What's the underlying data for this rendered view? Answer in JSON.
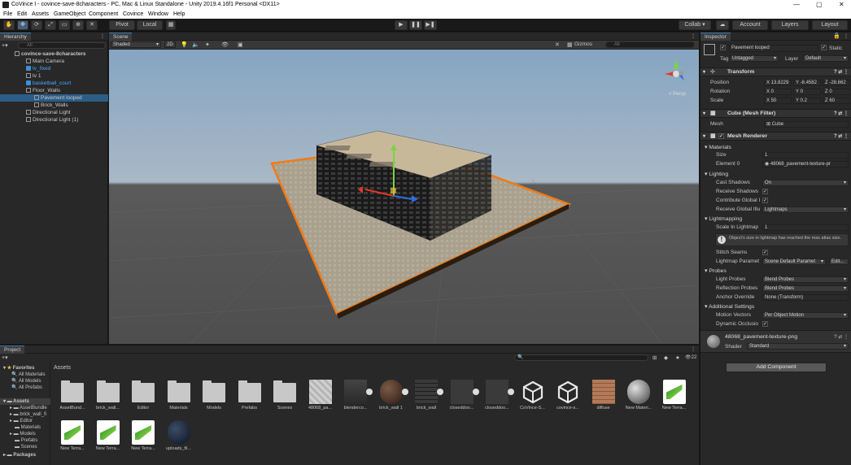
{
  "window": {
    "title": "CoVince I - covince-save-8characters - PC, Mac & Linux Standalone - Unity 2019.4.16f1 Personal <DX11>",
    "controls": [
      "—",
      "▢",
      "✕"
    ]
  },
  "menu": [
    "File",
    "Edit",
    "Assets",
    "GameObject",
    "Component",
    "Covince",
    "Window",
    "Help"
  ],
  "toolbar": {
    "pivot": "Pivot",
    "local": "Local",
    "collab": "Collab ▾",
    "account": "Account",
    "layers": "Layers",
    "layout": "Layout"
  },
  "hierarchy": {
    "tab": "Hierarchy",
    "search_placeholder": "All",
    "items": [
      {
        "label": "covince-save-8characters",
        "indent": 0,
        "bold": true
      },
      {
        "label": "Main Camera",
        "indent": 1
      },
      {
        "label": "tv_fixed",
        "indent": 1,
        "blue": true
      },
      {
        "label": "tv 1",
        "indent": 1
      },
      {
        "label": "basketball_court",
        "indent": 1,
        "blue": true
      },
      {
        "label": "Floor_Walls",
        "indent": 1
      },
      {
        "label": "Pavement looped",
        "indent": 2,
        "selected": true
      },
      {
        "label": "Brick_Walls",
        "indent": 2
      },
      {
        "label": "Directional Light",
        "indent": 1
      },
      {
        "label": "Directional Light (1)",
        "indent": 1
      }
    ]
  },
  "scene": {
    "tab": "Scene",
    "shading": "Shaded",
    "mode_2d": "2D",
    "gizmos": "Gizmos",
    "search_placeholder": "All",
    "persp": "< Persp"
  },
  "inspector": {
    "tab": "Inspector",
    "object_name": "Pavement looped",
    "static_label": "Static",
    "tag_label": "Tag",
    "tag_value": "Untagged",
    "layer_label": "Layer",
    "layer_value": "Default",
    "transform": {
      "title": "Transform",
      "position_label": "Position",
      "position": [
        "13.8229",
        "-8.4582",
        "-28.662"
      ],
      "rotation_label": "Rotation",
      "rotation": [
        "0",
        "0",
        "0"
      ],
      "scale_label": "Scale",
      "scale": [
        "50",
        "0.2",
        "60"
      ]
    },
    "mesh_filter": {
      "title": "Cube (Mesh Filter)",
      "mesh_label": "Mesh",
      "mesh_value": "Cube"
    },
    "mesh_renderer": {
      "title": "Mesh Renderer",
      "materials": "Materials",
      "size_label": "Size",
      "size_value": "1",
      "element0_label": "Element 0",
      "element0_value": "48068_pavement-texture-pr",
      "lighting": "Lighting",
      "cast_shadows_label": "Cast Shadows",
      "cast_shadows_value": "On",
      "receive_shadows_label": "Receive Shadows",
      "contribute_gi_label": "Contribute Global I",
      "receive_gi_label": "Receive Global Illu",
      "receive_gi_value": "Lightmaps",
      "lightmapping": "Lightmapping",
      "scale_lightmap_label": "Scale In Lightmap",
      "scale_lightmap_value": "1",
      "warning": "Object's size in lightmap has reached the max atlas size.",
      "stitch_label": "Stitch Seams",
      "lightmap_params_label": "Lightmap Paramet",
      "lightmap_params_value": "Scene Default Paramet",
      "edit_btn": "Edit...",
      "probes": "Probes",
      "light_probes_label": "Light Probes",
      "light_probes_value": "Blend Probes",
      "reflection_probes_label": "Reflection Probes",
      "reflection_probes_value": "Blend Probes",
      "anchor_label": "Anchor Override",
      "anchor_value": "None (Transform)",
      "additional": "Additional Settings",
      "motion_label": "Motion Vectors",
      "motion_value": "Per Object Motion",
      "dynamic_label": "Dynamic Occlusio"
    },
    "material": {
      "name": "48068_pavement-texture-png",
      "shader_label": "Shader",
      "shader_value": "Standard"
    },
    "add_component": "Add Component"
  },
  "project": {
    "tab": "Project",
    "breadcrumb": "Assets",
    "count": "22",
    "tree": [
      {
        "label": "Favorites",
        "bold": true,
        "indent": 0
      },
      {
        "label": "All Materials",
        "indent": 1
      },
      {
        "label": "All Models",
        "indent": 1
      },
      {
        "label": "All Prefabs",
        "indent": 1
      },
      {
        "label": "Assets",
        "bold": true,
        "indent": 0,
        "selected": true
      },
      {
        "label": "AssetBundle",
        "indent": 1
      },
      {
        "label": "brick_wall_fi",
        "indent": 1
      },
      {
        "label": "Editor",
        "indent": 1
      },
      {
        "label": "Materials",
        "indent": 1
      },
      {
        "label": "Models",
        "indent": 1
      },
      {
        "label": "Prefabs",
        "indent": 1
      },
      {
        "label": "Scenes",
        "indent": 1
      },
      {
        "label": "Packages",
        "bold": true,
        "indent": 0
      }
    ],
    "assets_row1": [
      {
        "label": "AssetBund...",
        "kind": "folder"
      },
      {
        "label": "brick_wall...",
        "kind": "folder"
      },
      {
        "label": "Editor",
        "kind": "folder"
      },
      {
        "label": "Materials",
        "kind": "folder"
      },
      {
        "label": "Models",
        "kind": "folder"
      },
      {
        "label": "Prefabs",
        "kind": "folder"
      },
      {
        "label": "Scenes",
        "kind": "folder"
      },
      {
        "label": "48068_pa...",
        "kind": "pavement"
      },
      {
        "label": "blenderco...",
        "kind": "model"
      },
      {
        "label": "brick_wall 1",
        "kind": "sphere-brick"
      },
      {
        "label": "brick_wall",
        "kind": "brick"
      },
      {
        "label": "closeddoo...",
        "kind": "dark"
      },
      {
        "label": "closeddoo...",
        "kind": "dark"
      },
      {
        "label": "CoVince-S...",
        "kind": "unity"
      },
      {
        "label": "covince-s...",
        "kind": "unity"
      },
      {
        "label": "diffuse",
        "kind": "diffuse"
      },
      {
        "label": "New Materi...",
        "kind": "sphere-grey"
      },
      {
        "label": "New Terra...",
        "kind": "terrain"
      }
    ],
    "assets_row2": [
      {
        "label": "New Terra...",
        "kind": "terrain"
      },
      {
        "label": "New Terra...",
        "kind": "terrain"
      },
      {
        "label": "New Terra...",
        "kind": "terrain"
      },
      {
        "label": "uploads_fil...",
        "kind": "sphere-dark"
      }
    ]
  },
  "colors": {
    "selection": "#2c5d87",
    "accent_orange": "#f07a16",
    "link_blue": "#4ca4ff"
  }
}
